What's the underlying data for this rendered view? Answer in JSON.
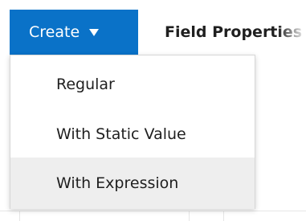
{
  "toolbar": {
    "create_label": "Create",
    "field_properties_label": "Field Properties"
  },
  "menu": {
    "items": [
      {
        "label": "Regular"
      },
      {
        "label": "With Static Value"
      },
      {
        "label": "With Expression"
      }
    ],
    "highlighted_item": "With Expression"
  },
  "colors": {
    "accent": "#0a72c8",
    "menu_hover": "#eeeeee",
    "text": "#1f1f1f"
  }
}
